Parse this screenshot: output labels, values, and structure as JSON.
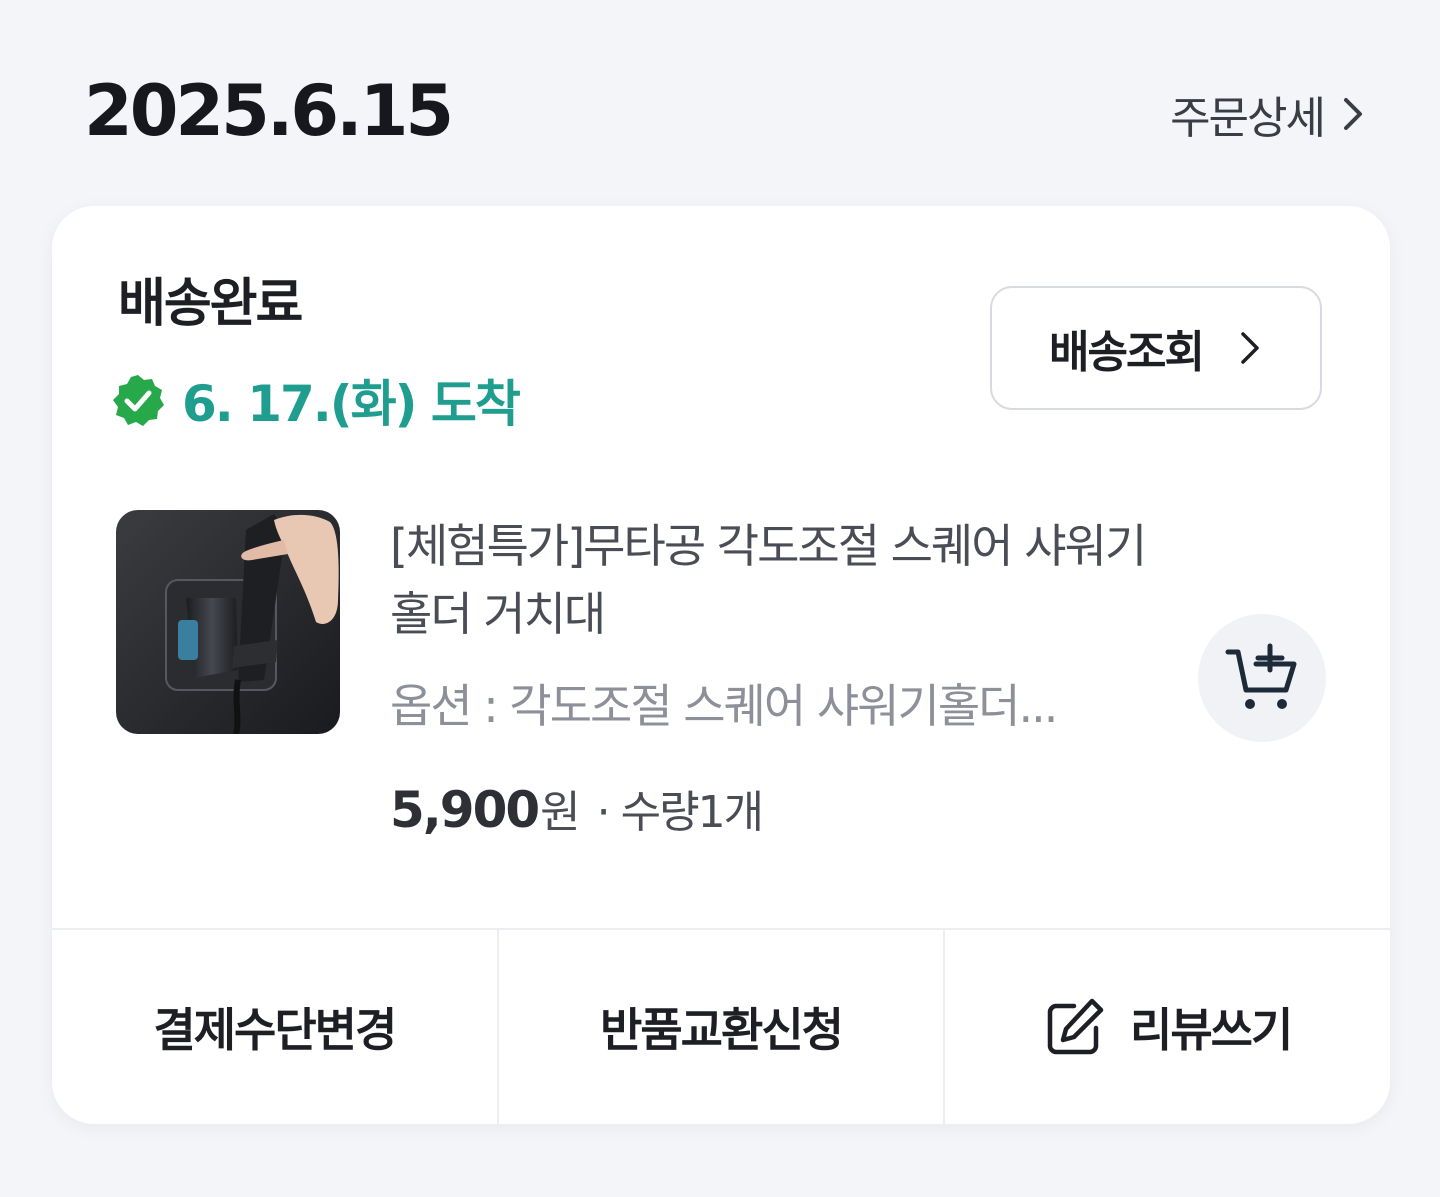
{
  "order": {
    "date": "2025.6.15",
    "detail_link": "주문상세"
  },
  "shipment": {
    "status": "배송완료",
    "arrival": "6. 17.(화) 도착",
    "track_button": "배송조회"
  },
  "product": {
    "name": "[체험특가]무타공 각도조절 스퀘어 샤워기 홀더 거치대",
    "option": "옵션 : 각도조절 스퀘어 샤워기홀더...",
    "price": "5,900",
    "currency": "원",
    "quantity": "· 수량1개"
  },
  "actions": {
    "change_payment": "결제수단변경",
    "return_exchange": "반품교환신청",
    "write_review": "리뷰쓰기"
  },
  "colors": {
    "accent_green": "#1f9e8f",
    "check_green": "#27a84a",
    "background": "#f4f5f8"
  },
  "icons": {
    "arrival": "check-badge-icon",
    "cart": "add-to-cart-icon",
    "review": "edit-icon",
    "chevron": "chevron-right-icon"
  }
}
